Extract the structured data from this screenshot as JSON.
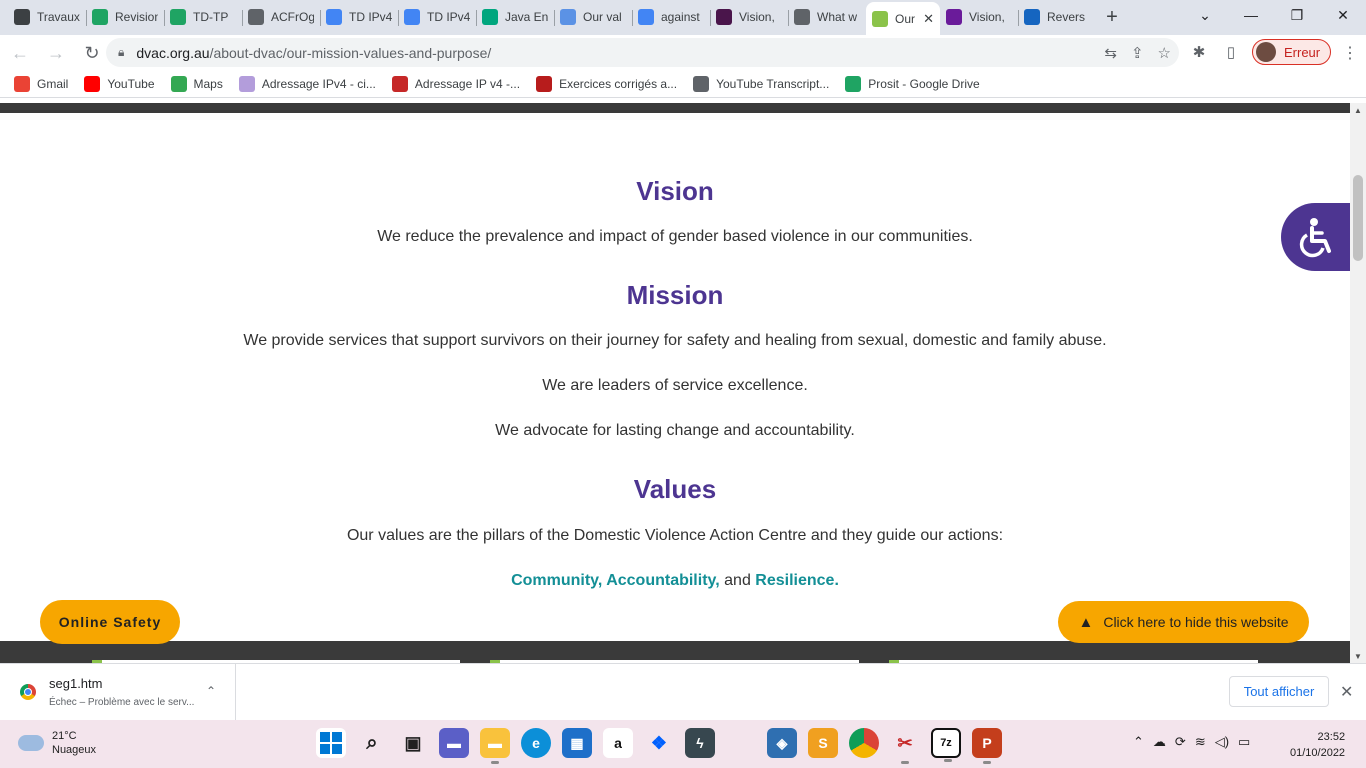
{
  "browser": {
    "tabs": [
      {
        "title": "Travaux",
        "icon": "classroom-icon",
        "color": "#3c4043"
      },
      {
        "title": "Revision",
        "icon": "drive-icon",
        "color": "#1fa463"
      },
      {
        "title": "TD-TP",
        "icon": "drive-icon",
        "color": "#1fa463"
      },
      {
        "title": "ACFrOg",
        "icon": "globe-icon",
        "color": "#5f6368"
      },
      {
        "title": "TD IPv4",
        "icon": "docs-icon",
        "color": "#4285f4"
      },
      {
        "title": "TD IPv4",
        "icon": "docs-icon",
        "color": "#4285f4"
      },
      {
        "title": "Java En",
        "icon": "wattpad-icon",
        "color": "#00a67e"
      },
      {
        "title": "Our val",
        "icon": "un-icon",
        "color": "#5b92e5"
      },
      {
        "title": "against",
        "icon": "google-icon",
        "color": "#4285f4"
      },
      {
        "title": "Vision,",
        "icon": "slack-icon",
        "color": "#4a154b"
      },
      {
        "title": "What w",
        "icon": "globe-icon",
        "color": "#5f6368"
      },
      {
        "title": "Our",
        "icon": "dvac-icon",
        "color": "#8bc34a",
        "active": true
      },
      {
        "title": "Vision,",
        "icon": "vision-icon",
        "color": "#6a1b9a"
      },
      {
        "title": "Revers",
        "icon": "reverso-icon",
        "color": "#1565c0"
      }
    ],
    "new_tab": "+",
    "url_host": "dvac.org.au",
    "url_path": "/about-dvac/our-mission-values-and-purpose/",
    "profile_label": "Erreur",
    "bookmarks": [
      {
        "label": "Gmail",
        "icon": "gmail-icon",
        "color": "#ea4335"
      },
      {
        "label": "YouTube",
        "icon": "youtube-icon",
        "color": "#ff0000"
      },
      {
        "label": "Maps",
        "icon": "maps-icon",
        "color": "#34a853"
      },
      {
        "label": "Adressage IPv4 - ci...",
        "icon": "puzzle-icon",
        "color": "#b39ddb"
      },
      {
        "label": "Adressage IP v4 -...",
        "icon": "at-icon",
        "color": "#c62828"
      },
      {
        "label": "Exercices corrigés a...",
        "icon": "mx-icon",
        "color": "#b71c1c"
      },
      {
        "label": "YouTube Transcript...",
        "icon": "globe-icon",
        "color": "#5f6368"
      },
      {
        "label": "Prosit - Google Drive",
        "icon": "drive-icon",
        "color": "#1fa463"
      }
    ]
  },
  "page": {
    "vision_title": "Vision",
    "vision_text": "We reduce the prevalence and impact of gender based violence in our communities.",
    "mission_title": "Mission",
    "mission_text_1": "We provide services that support survivors on their journey for safety and healing from sexual, domestic and family abuse.",
    "mission_text_2": "We are leaders of service excellence.",
    "mission_text_3": "We advocate for lasting change and accountability.",
    "values_title": "Values",
    "values_intro": "Our values are the pillars of the Domestic Violence Action Centre and they guide our actions:",
    "value_1": "Community, Accountability,",
    "value_and": "and",
    "value_2": "Resilience.",
    "online_safety_button": "Online Safety",
    "hide_site_button": "Click here to hide this website",
    "accent_color": "#4d3591",
    "teal_color": "#138f96",
    "button_color": "#f7a600"
  },
  "downloads": {
    "filename": "seg1.htm",
    "status": "Échec – Problème avec le serv...",
    "show_all": "Tout afficher"
  },
  "taskbar": {
    "temperature": "21°C",
    "weather": "Nuageux",
    "time": "23:52",
    "date": "01/10/2022"
  }
}
